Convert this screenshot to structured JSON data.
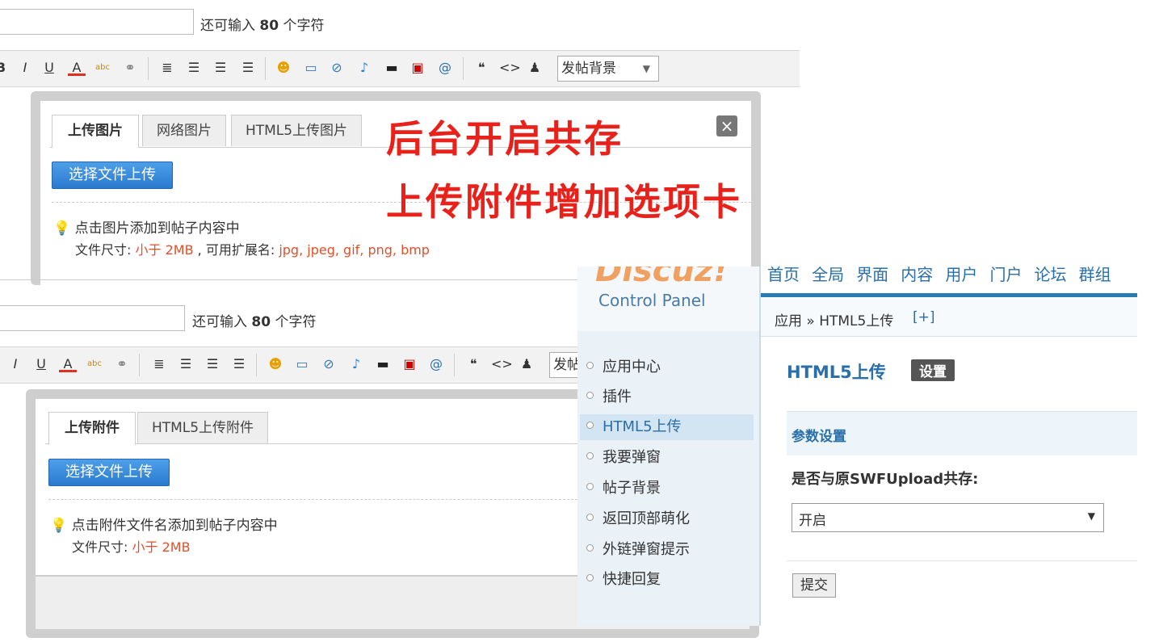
{
  "top_editor": {
    "hint_prefix": "还可输入",
    "hint_count": "80",
    "hint_suffix": "个字符",
    "bg_select": "发帖背景",
    "tabs": [
      "上传图片",
      "网络图片",
      "HTML5上传图片"
    ],
    "upload_button": "选择文件上传",
    "tip_line1": "点击图片添加到帖子内容中",
    "size_label": "文件尺寸:",
    "size_value": "小于 2MB",
    "ext_label": ", 可用扩展名:",
    "ext_value": "jpg, jpeg, gif, png, bmp",
    "close": "×"
  },
  "annotation": {
    "line1": "后台开启共存",
    "line2": "上传附件增加选项卡"
  },
  "bottom_editor": {
    "hint_prefix": "还可输入",
    "hint_count": "80",
    "hint_suffix": "个字符",
    "bg_select": "发帖",
    "tabs": [
      "上传附件",
      "HTML5上传附件"
    ],
    "upload_button": "选择文件上传",
    "tip_line1": "点击附件文件名添加到帖子内容中",
    "size_label": "文件尺寸:",
    "size_value": "小于 2MB"
  },
  "toolbar": {
    "bold": "B",
    "italic": "I",
    "underline": "U",
    "font_color": "A",
    "spell": "abc",
    "link": "⚭",
    "align1": "≣",
    "align2": "☰",
    "align3": "☰",
    "align4": "☰",
    "smiley": "☻",
    "image": "▭",
    "attach": "⊘",
    "music": "♪",
    "video": "▬",
    "flash": "▣",
    "at": "@",
    "quote": "❝",
    "code": "<>",
    "qq": "♟"
  },
  "control_panel": {
    "logo": "Discuz!",
    "logo_sub": "Control Panel",
    "nav": [
      "首页",
      "全局",
      "界面",
      "内容",
      "用户",
      "门户",
      "论坛",
      "群组"
    ],
    "breadcrumb": "应用 » HTML5上传",
    "breadcrumb_add": "[+]",
    "sidebar": [
      "应用中心",
      "插件",
      "HTML5上传",
      "我要弹窗",
      "帖子背景",
      "返回顶部萌化",
      "外链弹窗提示",
      "快捷回复"
    ],
    "page_title": "HTML5上传",
    "settings_badge": "设置",
    "section_title": "参数设置",
    "field_label": "是否与原SWFUpload共存:",
    "field_value": "开启",
    "submit": "提交"
  }
}
